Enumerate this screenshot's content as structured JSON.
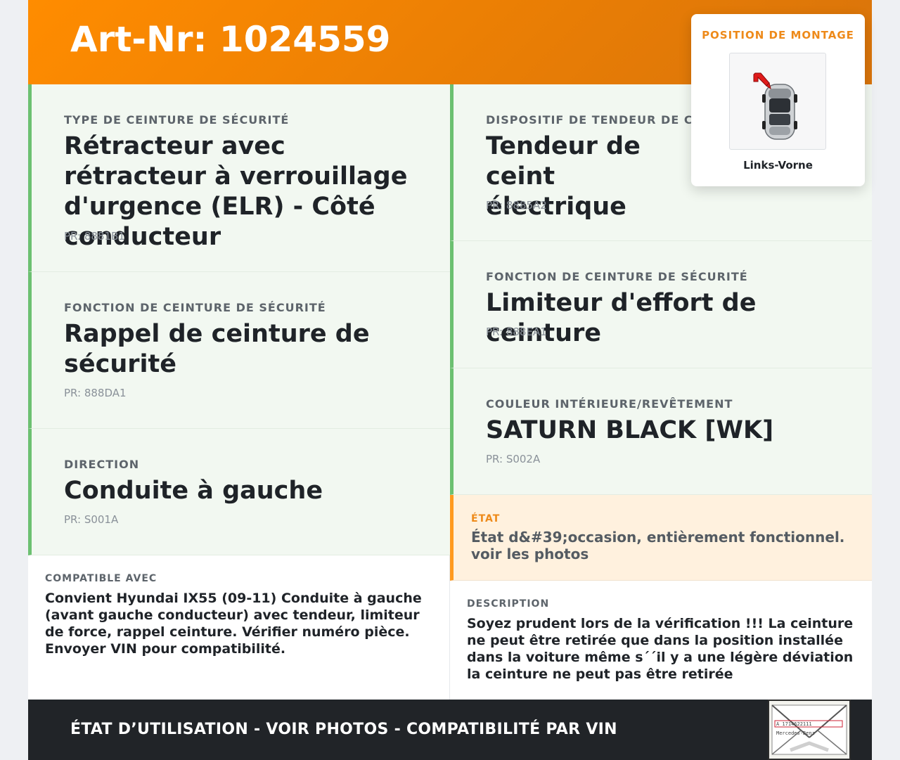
{
  "header": {
    "title": "Art-Nr: 1024559"
  },
  "left_cards": [
    {
      "label": "TYPE DE CEINTURE DE SÉCURITÉ",
      "value": "Rétracteur avec rétracteur à verrouillage d'urgence (ELR) - Côté conducteur",
      "pr": "PR: 8881B1"
    },
    {
      "label": "FONCTION DE CEINTURE DE SÉCURITÉ",
      "value": "Rappel de ceinture de sécurité",
      "pr": "PR: 888DA1"
    },
    {
      "label": "DIRECTION",
      "value": "Conduite à gauche",
      "pr": "PR: S001A"
    }
  ],
  "right_cards": [
    {
      "label": "DISPOSITIF DE TENDEUR DE CEINT",
      "value": "Tendeur de ceint électrique",
      "pr": "PR: 8885A2"
    },
    {
      "label": "FONCTION DE CEINTURE DE SÉCURITÉ",
      "value": "Limiteur d'effort de ceinture",
      "pr": "PR: 888EA1"
    },
    {
      "label": "COULEUR INTÉRIEURE/REVÊTEMENT",
      "value": "SATURN BLACK [WK]",
      "pr": "PR: S002A"
    }
  ],
  "etat": {
    "label": "ÉTAT",
    "text": "État d&#39;occasion, entièrement fonctionnel. voir les photos"
  },
  "compatible": {
    "label": "COMPATIBLE AVEC",
    "text": "Convient Hyundai IX55 (09-11) Conduite à gauche (avant gauche conducteur) avec tendeur, limiteur de force, rappel ceinture. Vérifier numéro pièce. Envoyer VIN pour compatibilité."
  },
  "description": {
    "label": "DESCRIPTION",
    "text": "Soyez prudent lors de la vérification !!! La ceinture ne peut être retirée que dans la position installée dans la voiture même s´´il y a une légère déviation la ceinture ne peut pas être retirée"
  },
  "mount": {
    "label": "POSITION DE MONTAGE",
    "position": "Links-Vorne",
    "icon": "car-top-view-icon"
  },
  "footer": {
    "text": "ÉTAT D’UTILISATION - VOIR PHOTOS - COMPATIBILITÉ PAR VIN",
    "stamp_text": "Mercedes-Benz"
  },
  "colors": {
    "accent": "#ff8c00",
    "green_border": "#6cc071",
    "card_bg": "#f2f8f1",
    "etat_bg": "#fff1de",
    "footer_bg": "#212428"
  }
}
